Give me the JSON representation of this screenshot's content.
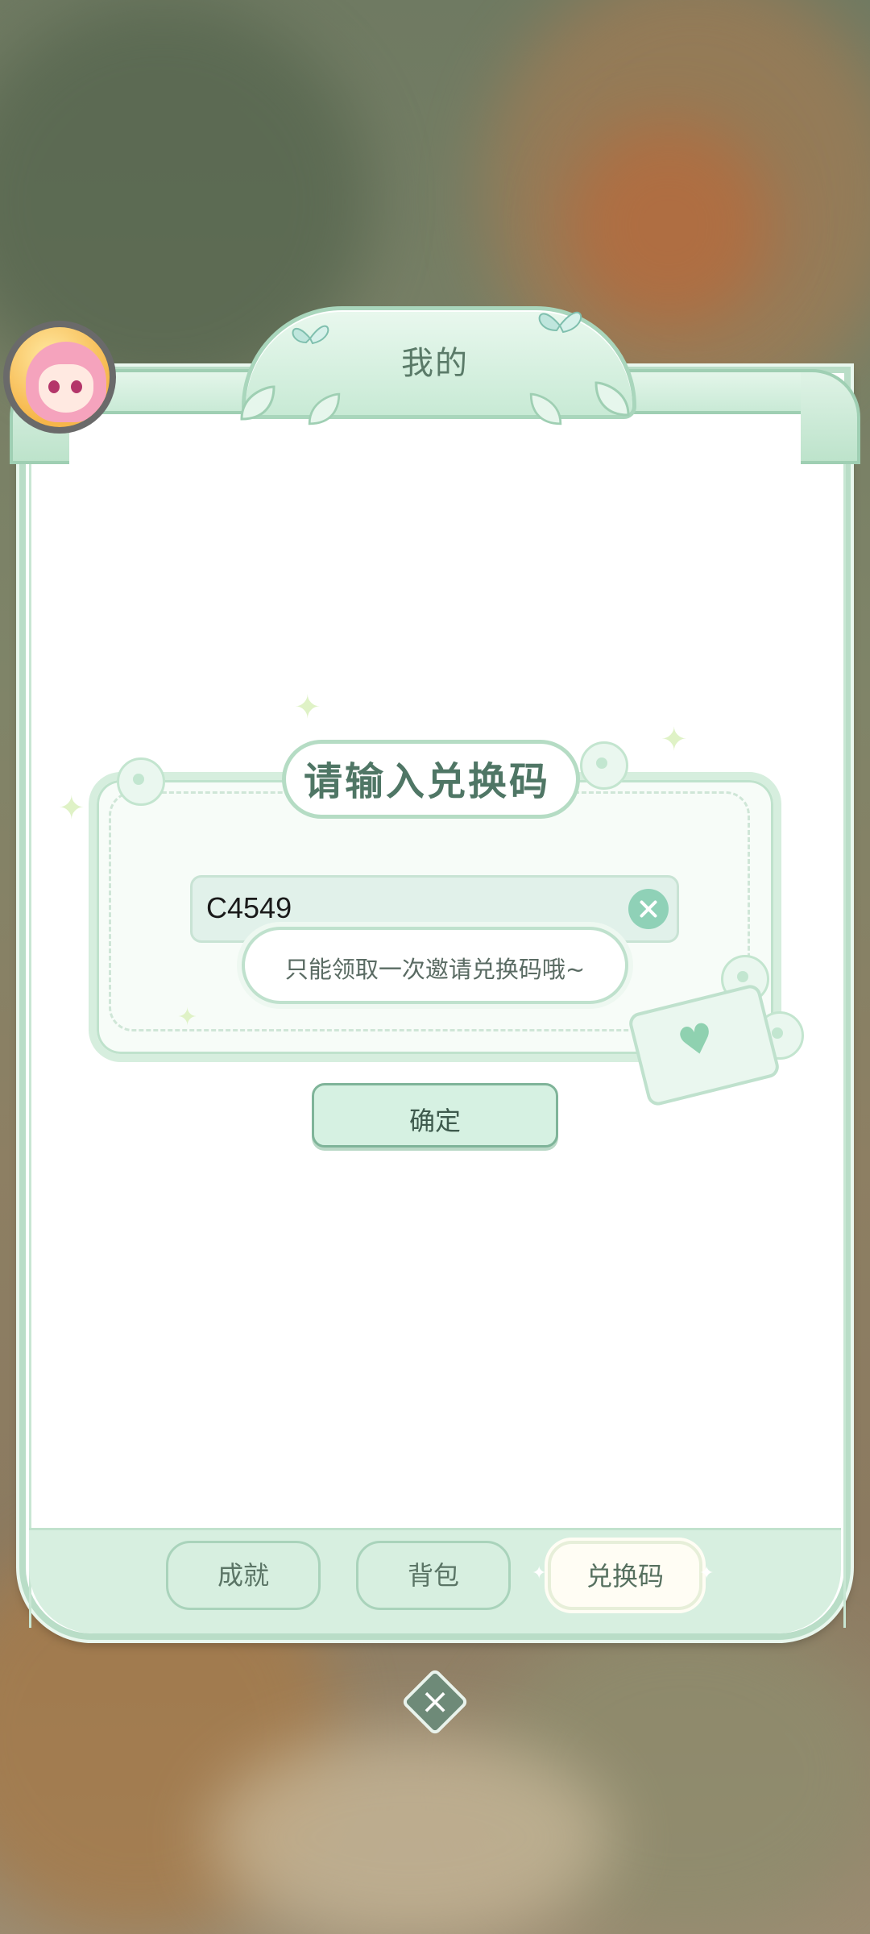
{
  "panel": {
    "title": "我的"
  },
  "redeem": {
    "title": "请输入兑换码",
    "code_value": "C4549",
    "toast_message": "只能领取一次邀请兑换码哦~",
    "confirm_label": "确定"
  },
  "tabs": [
    {
      "label": "成就",
      "active": false
    },
    {
      "label": "背包",
      "active": false
    },
    {
      "label": "兑换码",
      "active": true
    }
  ],
  "icons": {
    "close": "close-icon",
    "clear": "clear-icon"
  },
  "colors": {
    "accent": "#8fd1b7",
    "panel_border": "#b9ddc7",
    "tab_bar": "#d7efe0"
  }
}
